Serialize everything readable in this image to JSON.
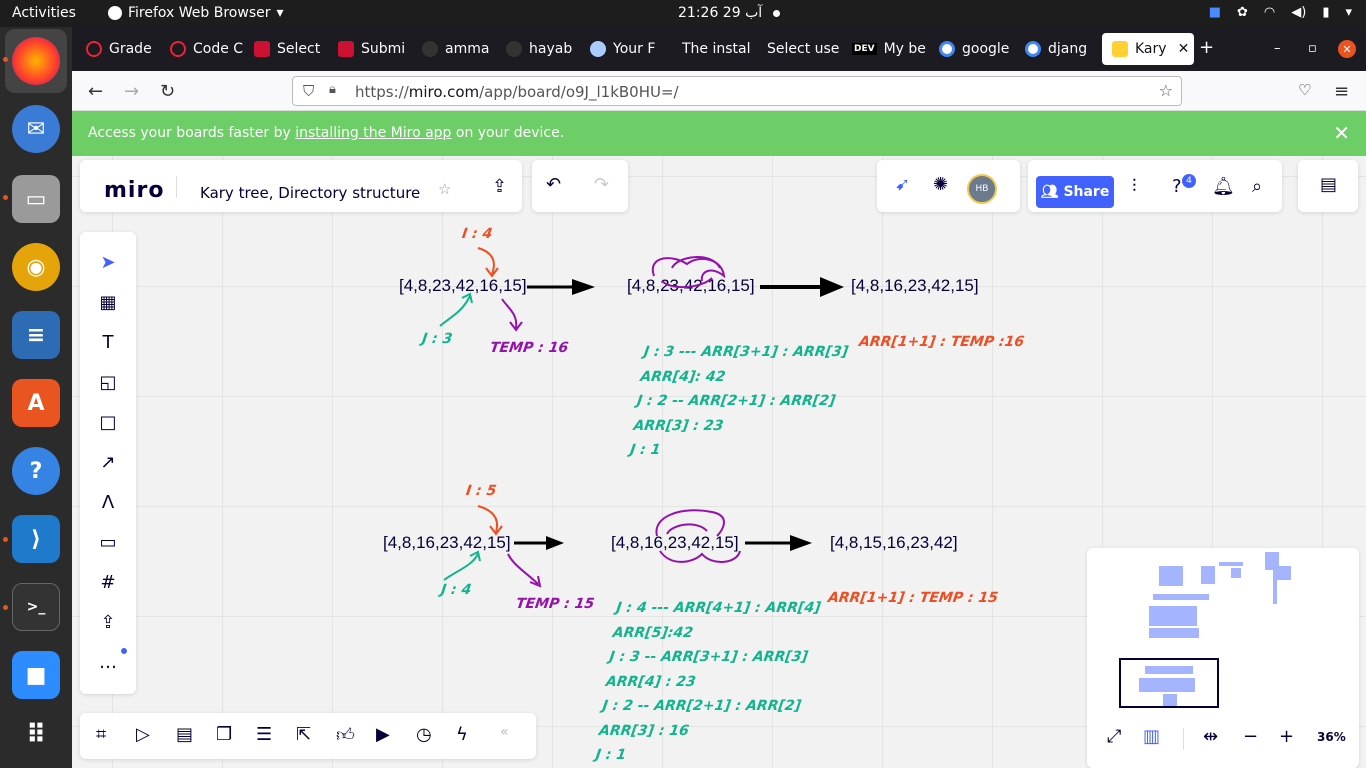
{
  "os": {
    "activities": "Activities",
    "app_name": "Firefox Web Browser",
    "clock": "21:26  آب 29"
  },
  "tabs": [
    {
      "label": "Grade",
      "color": "#ee2233"
    },
    {
      "label": "Code C",
      "color": "#ee2233"
    },
    {
      "label": "Select",
      "color": "#cc1133"
    },
    {
      "label": "Submi",
      "color": "#cc1133"
    },
    {
      "label": "amma",
      "color": "#333333"
    },
    {
      "label": "hayab",
      "color": "#333333"
    },
    {
      "label": "Your F",
      "color": "#aaccff"
    },
    {
      "label": "The instal",
      "color": "#1c1b22"
    },
    {
      "label": "Select use",
      "color": "#1c1b22"
    },
    {
      "label": "My be",
      "color": "#000000",
      "prefix": "DEV"
    },
    {
      "label": "google",
      "color": "#4285f4"
    },
    {
      "label": "djang",
      "color": "#4285f4"
    },
    {
      "label": "Kary",
      "color": "#ffd02f"
    }
  ],
  "browser": {
    "url_prefix": "https://",
    "url_host": "miro.com",
    "url_path": "/app/board/o9J_l1kB0HU=/"
  },
  "banner": {
    "text_before": "Access your boards faster by ",
    "link": "installing the Miro app",
    "text_after": " on your device."
  },
  "miro": {
    "logo": "miro",
    "board_title": "Kary tree, Directory structure",
    "share_label": "Share",
    "avatar": "HB",
    "help_badge": "4",
    "zoom": "36%"
  },
  "board": {
    "row1": {
      "arr1": "[4,8,23,42,16,15]",
      "arr2": "[4,8,23,42,16,15]",
      "arr3": "[4,8,16,23,42,15]",
      "i_label": "I : 4",
      "j_label": "J : 3",
      "temp_label": "TEMP : 16",
      "steps": [
        "J : 3 --- ARR[3+1] : ARR[3]",
        "ARR[4]: 42",
        "J : 2 -- ARR[2+1] : ARR[2]",
        "ARR[3] : 23",
        "J : 1"
      ],
      "result": "ARR[1+1] : TEMP :16"
    },
    "row2": {
      "arr1": "[4,8,16,23,42,15]",
      "arr2": "[4,8,16,23,42,15]",
      "arr3": "[4,8,15,16,23,42]",
      "i_label": "I : 5",
      "j_label": "J : 4",
      "temp_label": "TEMP : 15",
      "steps": [
        "J : 4 --- ARR[4+1] : ARR[4]",
        "ARR[5]:42",
        "J : 3 -- ARR[3+1] : ARR[3]",
        "ARR[4] : 23",
        "J : 2 -- ARR[2+1] : ARR[2]",
        "ARR[3] : 16",
        "J : 1"
      ],
      "result": "ARR[1+1] : TEMP : 15"
    }
  }
}
